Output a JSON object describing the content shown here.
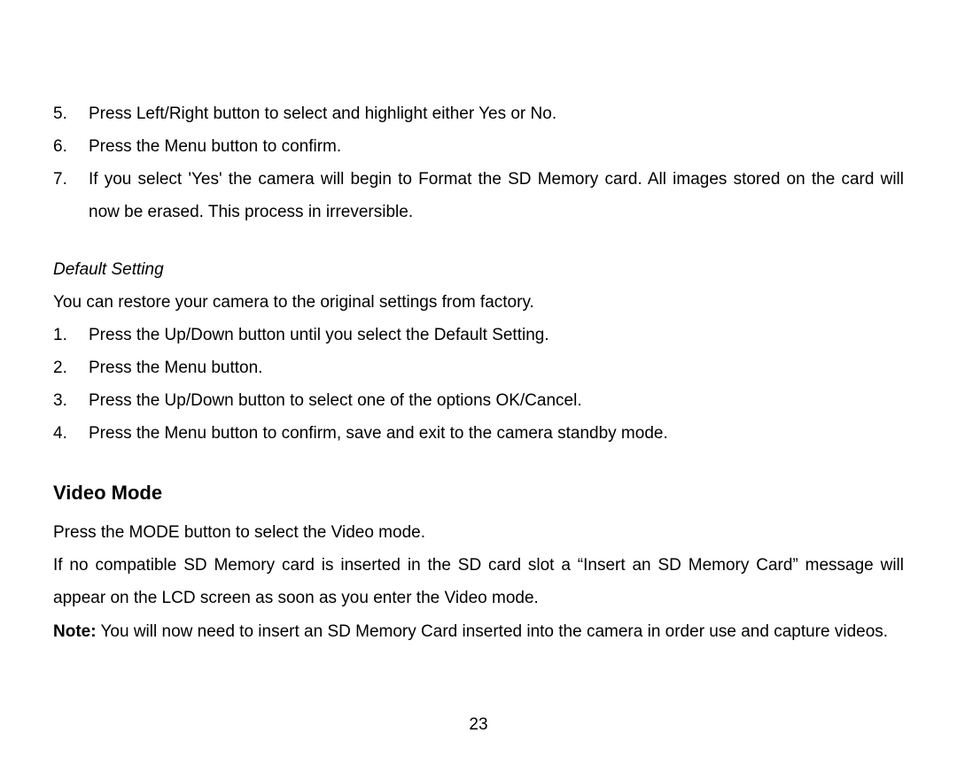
{
  "list1": {
    "items": [
      {
        "num": "5.",
        "text": "Press Left/Right button to select and highlight either Yes or No."
      },
      {
        "num": "6.",
        "text": "Press the Menu button to confirm."
      },
      {
        "num": "7.",
        "text": "If you select 'Yes' the camera will begin to Format the SD Memory card. All images stored on the card will now be erased. This process in irreversible."
      }
    ]
  },
  "default_setting": {
    "heading": "Default Setting",
    "intro": "You can restore your camera to the original settings from factory.",
    "items": [
      {
        "num": "1.",
        "text": "Press the Up/Down button until you select the Default Setting."
      },
      {
        "num": "2.",
        "text": "Press the Menu button."
      },
      {
        "num": "3.",
        "text": "Press the Up/Down button to select one of the options OK/Cancel."
      },
      {
        "num": "4.",
        "text": "Press the Menu button to confirm, save and exit to the camera standby mode."
      }
    ]
  },
  "video_mode": {
    "heading": "Video Mode",
    "p1": "Press the MODE button to select the Video mode.",
    "p2": "If no compatible SD Memory card is inserted in the SD card slot a “Insert an SD Memory Card” message will appear on the LCD screen as soon as you enter the Video mode.",
    "note_label": "Note:",
    "note_text": " You will now need to insert an SD Memory Card inserted into the camera in order use and capture videos."
  },
  "page_number": "23"
}
